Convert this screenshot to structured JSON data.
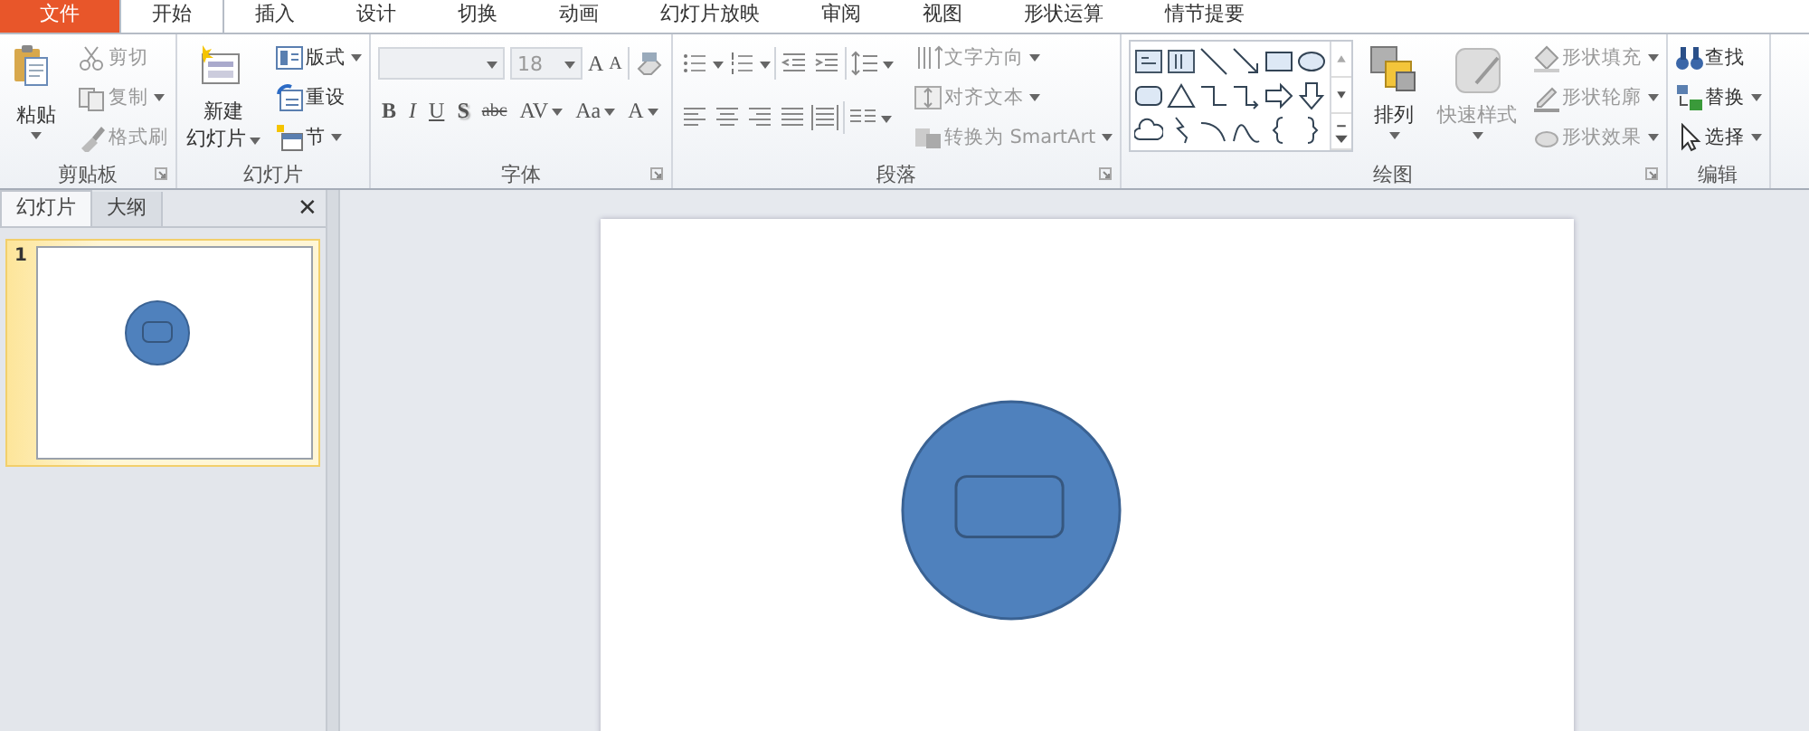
{
  "tabs": [
    {
      "label": "文件",
      "kind": "file",
      "selected": false
    },
    {
      "label": "开始",
      "kind": "normal",
      "selected": true
    },
    {
      "label": "插入",
      "kind": "normal",
      "selected": false
    },
    {
      "label": "设计",
      "kind": "normal",
      "selected": false
    },
    {
      "label": "切换",
      "kind": "normal",
      "selected": false
    },
    {
      "label": "动画",
      "kind": "normal",
      "selected": false
    },
    {
      "label": "幻灯片放映",
      "kind": "normal",
      "selected": false
    },
    {
      "label": "审阅",
      "kind": "normal",
      "selected": false
    },
    {
      "label": "视图",
      "kind": "normal",
      "selected": false
    },
    {
      "label": "形状运算",
      "kind": "normal",
      "selected": false
    },
    {
      "label": "情节提要",
      "kind": "normal",
      "selected": false
    }
  ],
  "groups": [
    {
      "kind": "clipboard",
      "name": "剪贴板",
      "launcher": true,
      "large": [
        {
          "label": "粘贴",
          "dropdown": true,
          "disabled": false
        }
      ],
      "small": [
        {
          "label": "剪切",
          "dropdown": false,
          "disabled": true
        },
        {
          "label": "复制",
          "dropdown": true,
          "disabled": true
        },
        {
          "label": "格式刷",
          "dropdown": false,
          "disabled": true
        }
      ]
    },
    {
      "kind": "slides",
      "name": "幻灯片",
      "launcher": false,
      "large": [
        {
          "lines": [
            "新建",
            "幻灯片"
          ],
          "dropdown": true,
          "disabled": false
        }
      ],
      "small": [
        {
          "label": "版式",
          "dropdown": true,
          "disabled": false
        },
        {
          "label": "重设",
          "dropdown": false,
          "disabled": false
        },
        {
          "label": "节",
          "dropdown": true,
          "disabled": false
        }
      ]
    },
    {
      "kind": "font",
      "name": "字体",
      "launcher": true,
      "font_field": {
        "disabled": true
      },
      "size_field": {
        "value": "18",
        "disabled": true
      },
      "size_buttons": [
        {
          "label": "A"
        },
        {
          "label": "A"
        }
      ],
      "buttons": [
        {
          "label": "B",
          "dropdown": false
        },
        {
          "label": "I",
          "dropdown": false
        },
        {
          "label": "U",
          "dropdown": false
        },
        {
          "label": "S",
          "dropdown": false
        },
        {
          "label": "abc",
          "dropdown": false
        },
        {
          "label": "AV",
          "dropdown": true
        },
        {
          "label": "Aa",
          "dropdown": true
        },
        {
          "label": "A",
          "dropdown": true
        }
      ]
    },
    {
      "kind": "paragraph",
      "name": "段落",
      "launcher": true,
      "small": [
        {
          "label": "文字方向",
          "dropdown": true,
          "disabled": true
        },
        {
          "label": "对齐文本",
          "dropdown": true,
          "disabled": true
        },
        {
          "label": "转换为 SmartArt",
          "dropdown": true,
          "disabled": true
        }
      ]
    },
    {
      "kind": "drawing",
      "name": "绘图",
      "launcher": true,
      "large": [
        {
          "label": "排列",
          "dropdown": true,
          "disabled": false
        },
        {
          "label": "快速样式",
          "dropdown": true,
          "disabled": true
        }
      ],
      "small": [
        {
          "label": "形状填充",
          "dropdown": true,
          "disabled": true
        },
        {
          "label": "形状轮廓",
          "dropdown": true,
          "disabled": true
        },
        {
          "label": "形状效果",
          "dropdown": true,
          "disabled": true
        }
      ]
    },
    {
      "kind": "editing",
      "name": "编辑",
      "launcher": false,
      "small": [
        {
          "label": "查找",
          "dropdown": false,
          "disabled": false
        },
        {
          "label": "替换",
          "dropdown": true,
          "disabled": false
        },
        {
          "label": "选择",
          "dropdown": true,
          "disabled": false
        }
      ]
    }
  ],
  "panel": {
    "tabs": [
      {
        "label": "幻灯片",
        "selected": true
      },
      {
        "label": "大纲",
        "selected": false
      }
    ],
    "close": "✕",
    "slides": [
      {
        "number": "1",
        "selected": true
      }
    ]
  }
}
